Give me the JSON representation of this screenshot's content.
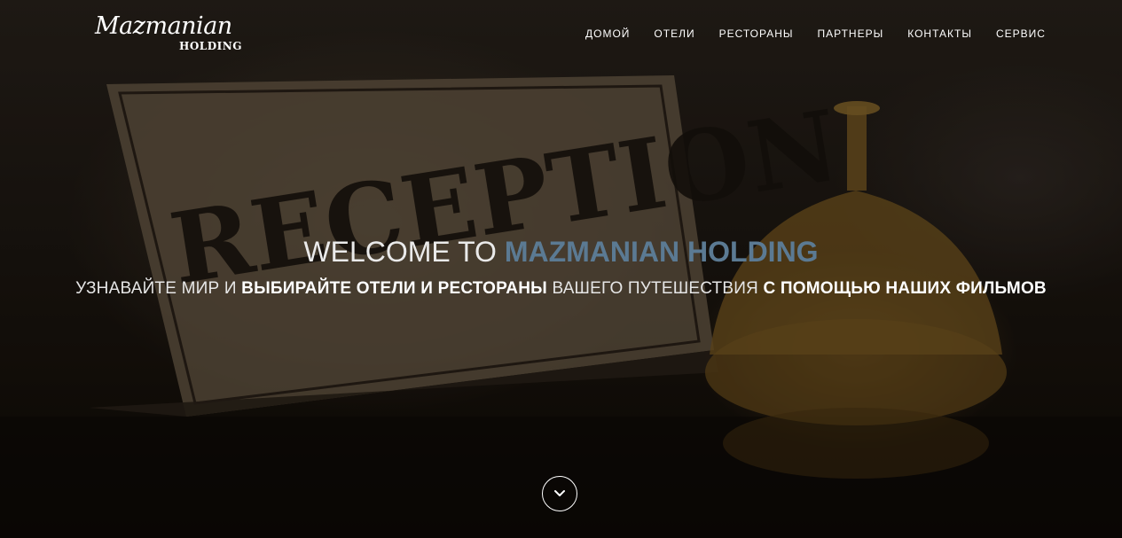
{
  "brand": {
    "name": "Mazmanian",
    "subtitle": "HOLDING"
  },
  "nav": [
    {
      "label": "ДОМОЙ"
    },
    {
      "label": "ОТЕЛИ"
    },
    {
      "label": "РЕСТОРАНЫ"
    },
    {
      "label": "ПАРТНЕРЫ"
    },
    {
      "label": "КОНТАКТЫ"
    },
    {
      "label": "СЕРВИС"
    }
  ],
  "hero": {
    "title_prefix": "WELCOME TO",
    "title_accent": "MAZMANIAN HOLDING",
    "subtitle_parts": [
      "УЗНАВАЙТЕ МИР И ",
      "ВЫБИРАЙТЕ ОТЕЛИ И РЕСТОРАНЫ",
      " ВАШЕГО ПУТЕШЕСТВИЯ ",
      "С ПОМОЩЬЮ НАШИХ ФИЛЬМОВ"
    ],
    "background_sign_text": "RECEPTION",
    "scroll_icon": "chevron-down-icon"
  },
  "colors": {
    "accent": "#5b7a93",
    "text": "#ffffff"
  }
}
